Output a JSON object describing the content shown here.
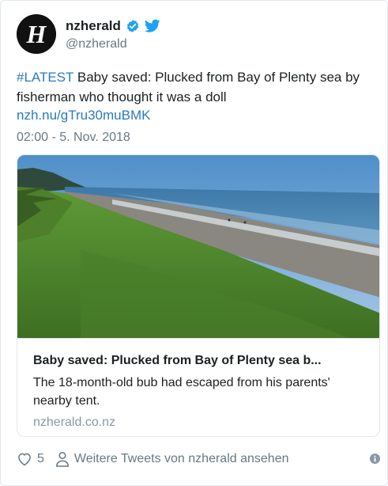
{
  "author": {
    "name": "nzherald",
    "handle": "@nzherald",
    "avatar_letter": "H",
    "verified": true
  },
  "tweet": {
    "hashtag": "#LATEST",
    "text": " Baby saved: Plucked from Bay of Plenty sea by fisherman who thought it was a doll",
    "link": "nzh.nu/gTru30muBMK",
    "timestamp": "02:00 - 5. Nov. 2018"
  },
  "card": {
    "title": "Baby saved: Plucked from Bay of Plenty sea b...",
    "description": "The 18-month-old bub had escaped from his parents' nearby tent.",
    "domain": "nzherald.co.nz"
  },
  "actions": {
    "like_count": "5",
    "more_tweets_label": "Weitere Tweets von nzherald ansehen"
  },
  "icons": {
    "verified": "verified-badge-icon",
    "twitter": "twitter-bird-icon",
    "like": "heart-icon",
    "profile": "person-icon",
    "info": "info-icon"
  },
  "colors": {
    "link": "#2b7bb9",
    "verified": "#1da1f2",
    "muted": "#697882"
  }
}
